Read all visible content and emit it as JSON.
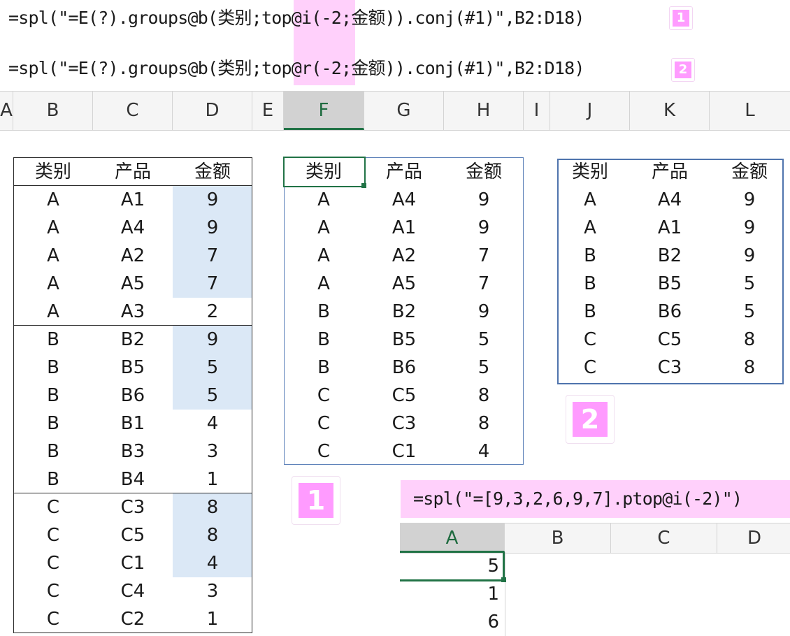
{
  "formulas": {
    "f1": {
      "pre": "=spl(\"=E(?).groups@b(类别;",
      "hl": "top@i",
      "post": "(-2;金额)).conj(#1)\",B2:D18)",
      "badge": "1"
    },
    "f2": {
      "pre": "=spl(\"=E(?).groups@b(类别;",
      "hl": "top@r",
      "post": "(-2;金额)).conj(#1)\",B2:D18)",
      "badge": "2"
    },
    "f3": {
      "text": "=spl(\"=[9,3,2,6,9,7].ptop@i(-2)\")"
    }
  },
  "column_headers": [
    "A",
    "B",
    "C",
    "D",
    "E",
    "F",
    "G",
    "H",
    "I",
    "J",
    "K",
    "L"
  ],
  "selected_column": "F",
  "source_table": {
    "headers": [
      "类别",
      "产品",
      "金额"
    ],
    "rows": [
      [
        "A",
        "A1",
        "9"
      ],
      [
        "A",
        "A4",
        "9"
      ],
      [
        "A",
        "A2",
        "7"
      ],
      [
        "A",
        "A5",
        "7"
      ],
      [
        "A",
        "A3",
        "2"
      ],
      [
        "B",
        "B2",
        "9"
      ],
      [
        "B",
        "B5",
        "5"
      ],
      [
        "B",
        "B6",
        "5"
      ],
      [
        "B",
        "B1",
        "4"
      ],
      [
        "B",
        "B3",
        "3"
      ],
      [
        "B",
        "B4",
        "1"
      ],
      [
        "C",
        "C3",
        "8"
      ],
      [
        "C",
        "C5",
        "8"
      ],
      [
        "C",
        "C1",
        "4"
      ],
      [
        "C",
        "C4",
        "3"
      ],
      [
        "C",
        "C2",
        "1"
      ]
    ]
  },
  "result_i": {
    "headers": [
      "类别",
      "产品",
      "金额"
    ],
    "rows": [
      [
        "A",
        "A4",
        "9"
      ],
      [
        "A",
        "A1",
        "9"
      ],
      [
        "A",
        "A2",
        "7"
      ],
      [
        "A",
        "A5",
        "7"
      ],
      [
        "B",
        "B2",
        "9"
      ],
      [
        "B",
        "B5",
        "5"
      ],
      [
        "B",
        "B6",
        "5"
      ],
      [
        "C",
        "C5",
        "8"
      ],
      [
        "C",
        "C3",
        "8"
      ],
      [
        "C",
        "C1",
        "4"
      ]
    ],
    "badge": "1"
  },
  "result_r": {
    "headers": [
      "类别",
      "产品",
      "金额"
    ],
    "rows": [
      [
        "A",
        "A4",
        "9"
      ],
      [
        "A",
        "A1",
        "9"
      ],
      [
        "B",
        "B2",
        "9"
      ],
      [
        "B",
        "B5",
        "5"
      ],
      [
        "B",
        "B6",
        "5"
      ],
      [
        "C",
        "C5",
        "8"
      ],
      [
        "C",
        "C3",
        "8"
      ]
    ],
    "badge": "2"
  },
  "sheet2": {
    "column_headers": [
      "A",
      "B",
      "C",
      "D"
    ],
    "selected_column": "A",
    "values": [
      "5",
      "1",
      "6"
    ]
  }
}
